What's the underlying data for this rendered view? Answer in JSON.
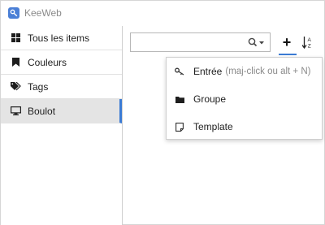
{
  "window": {
    "title": "KeeWeb"
  },
  "sidebar": {
    "items": [
      {
        "label": "Tous les items",
        "icon": "grid-icon",
        "active": false
      },
      {
        "label": "Couleurs",
        "icon": "bookmark-icon",
        "active": false
      },
      {
        "label": "Tags",
        "icon": "tags-icon",
        "active": false
      },
      {
        "label": "Boulot",
        "icon": "monitor-icon",
        "active": true
      }
    ]
  },
  "toolbar": {
    "search_value": "",
    "search_icon": "search-icon",
    "add_label": "+",
    "sort_icon": "sort-alpha-icon"
  },
  "dropdown": {
    "items": [
      {
        "label": "Entrée",
        "hint": "(maj-click ou alt + N)",
        "icon": "key-icon"
      },
      {
        "label": "Groupe",
        "icon": "folder-icon"
      },
      {
        "label": "Template",
        "icon": "sticky-note-icon"
      }
    ]
  },
  "colors": {
    "accent": "#3b7bd4",
    "active_bg": "#e4e4e4"
  }
}
